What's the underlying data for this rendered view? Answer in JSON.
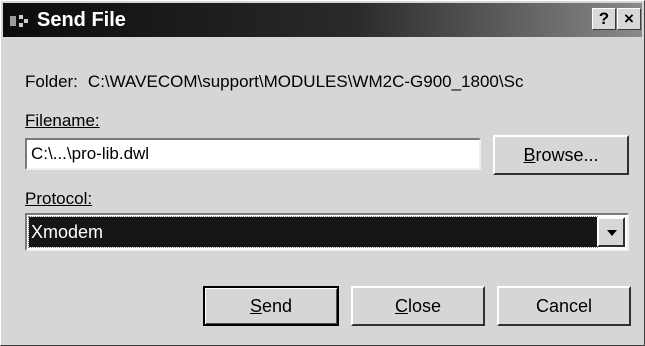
{
  "window": {
    "title": "Send File",
    "help_glyph": "?",
    "close_glyph": "×"
  },
  "folder": {
    "label": "Folder:",
    "path": "C:\\WAVECOM\\support\\MODULES\\WM2C-G900_1800\\Sc"
  },
  "filename": {
    "label": "Filename:",
    "value": "C:\\...\\pro-lib.dwl"
  },
  "browse": {
    "mnemonic": "B",
    "rest": "rowse..."
  },
  "protocol": {
    "label": "Protocol:",
    "selected": "Xmodem"
  },
  "buttons": {
    "send_mnemonic": "S",
    "send_rest": "end",
    "close_mnemonic": "C",
    "close_rest": "lose",
    "cancel_label": "Cancel"
  },
  "icons": {
    "app": "app-icon",
    "help": "help-icon",
    "close": "close-icon",
    "dropdown": "chevron-down-icon"
  }
}
